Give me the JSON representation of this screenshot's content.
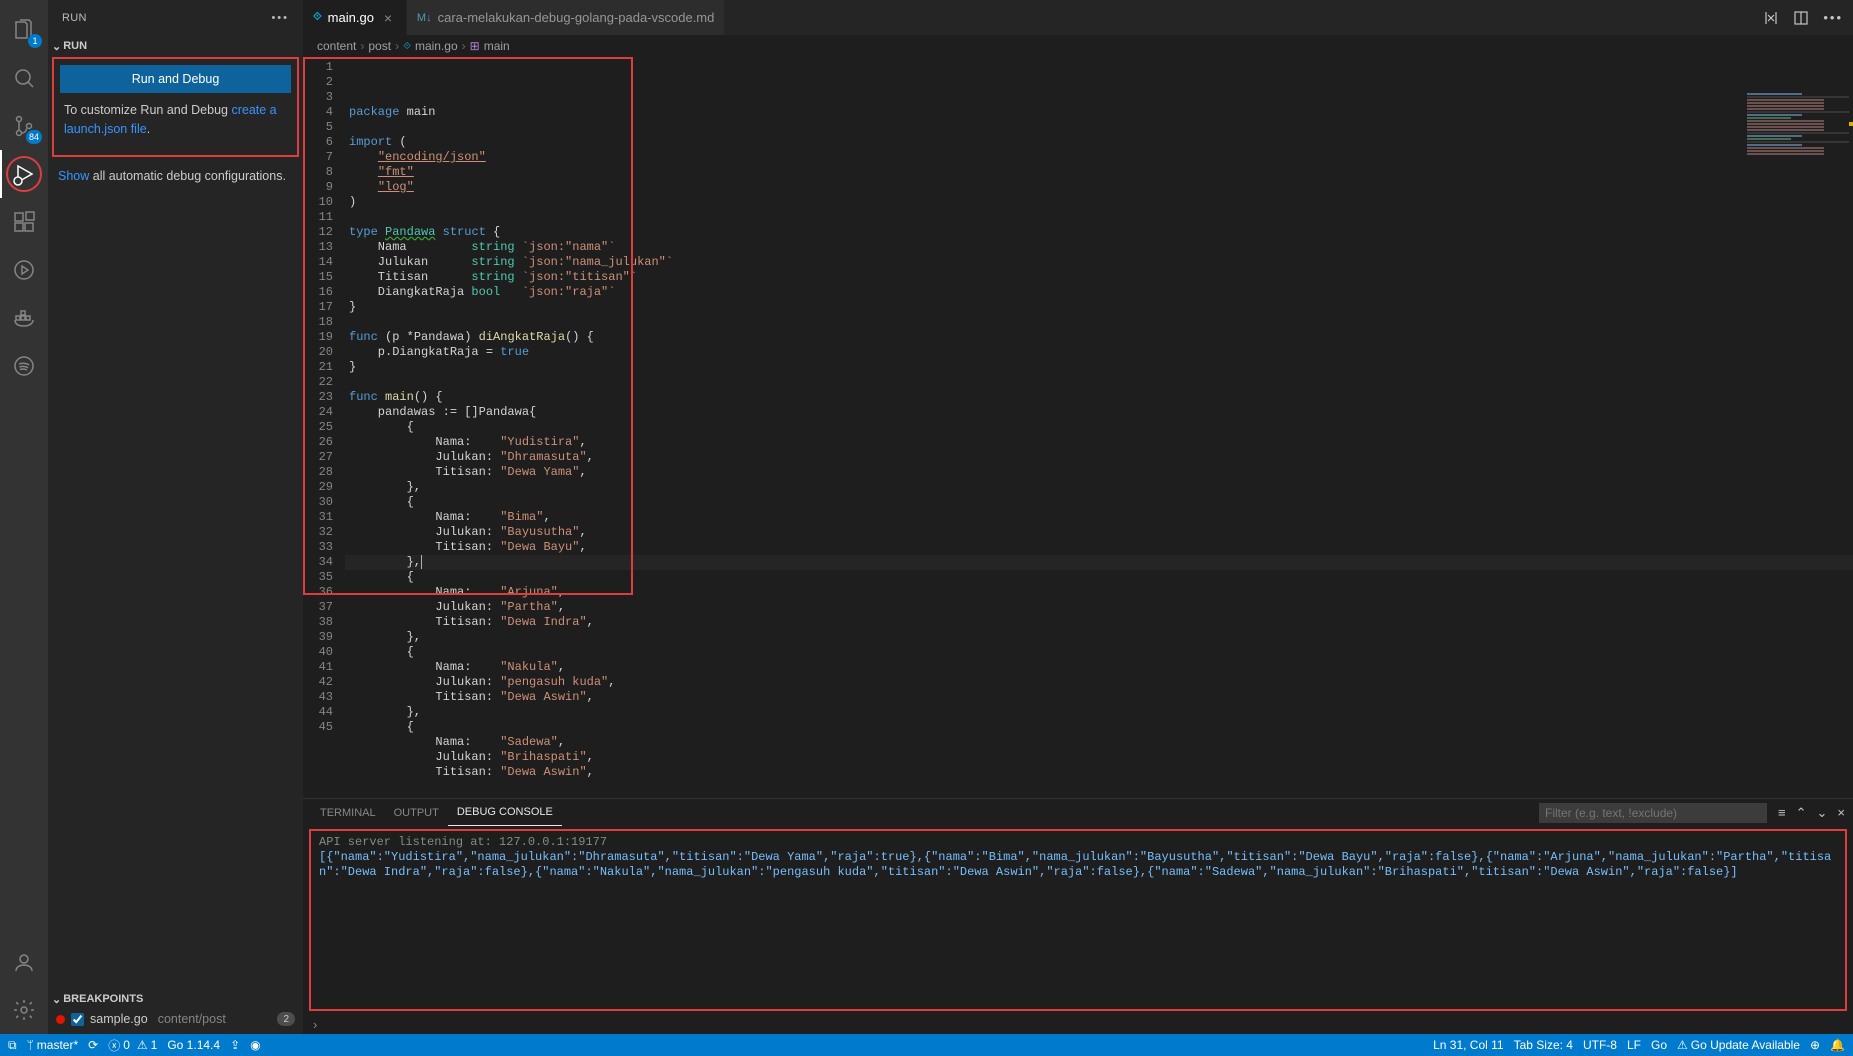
{
  "sidebar": {
    "title": "RUN",
    "section_run": "RUN",
    "run_debug_btn": "Run and Debug",
    "customize_pre": "To customize Run and Debug ",
    "customize_link": "create a launch.json file",
    "customize_post": ".",
    "show_pre": "Show",
    "show_post": " all automatic debug configurations.",
    "section_breakpoints": "BREAKPOINTS",
    "bp_file": "sample.go",
    "bp_path": "content/post",
    "bp_count": "2",
    "explorer_badge": "1",
    "scm_badge": "84"
  },
  "tabs": {
    "t1": "main.go",
    "t2": "cara-melakukan-debug-golang-pada-vscode.md"
  },
  "breadcrumb": {
    "b1": "content",
    "b2": "post",
    "b3": "main.go",
    "b4": "main"
  },
  "code_lines": [
    {
      "n": "1",
      "seg": [
        [
          "kw",
          "package"
        ],
        [
          "op",
          " main"
        ]
      ]
    },
    {
      "n": "2",
      "seg": []
    },
    {
      "n": "3",
      "seg": [
        [
          "kw",
          "import"
        ],
        [
          "op",
          " ("
        ]
      ]
    },
    {
      "n": "4",
      "seg": [
        [
          "op",
          "    "
        ],
        [
          "strimp",
          "\"encoding/json\""
        ]
      ]
    },
    {
      "n": "5",
      "seg": [
        [
          "op",
          "    "
        ],
        [
          "strimp",
          "\"fmt\""
        ]
      ]
    },
    {
      "n": "6",
      "seg": [
        [
          "op",
          "    "
        ],
        [
          "strimp",
          "\"log\""
        ]
      ]
    },
    {
      "n": "7",
      "seg": [
        [
          "op",
          ")"
        ]
      ]
    },
    {
      "n": "8",
      "seg": []
    },
    {
      "n": "9",
      "seg": [
        [
          "kw",
          "type"
        ],
        [
          "op",
          " "
        ],
        [
          "ctyp",
          "Pandawa"
        ],
        [
          "op",
          " "
        ],
        [
          "kw",
          "struct"
        ],
        [
          "op",
          " {"
        ]
      ]
    },
    {
      "n": "10",
      "seg": [
        [
          "op",
          "    Nama         "
        ],
        [
          "typ",
          "string"
        ],
        [
          "op",
          " "
        ],
        [
          "str",
          "`json:\"nama\"`"
        ]
      ]
    },
    {
      "n": "11",
      "seg": [
        [
          "op",
          "    Julukan      "
        ],
        [
          "typ",
          "string"
        ],
        [
          "op",
          " "
        ],
        [
          "str",
          "`json:\"nama_julukan\"`"
        ]
      ]
    },
    {
      "n": "12",
      "seg": [
        [
          "op",
          "    Titisan      "
        ],
        [
          "typ",
          "string"
        ],
        [
          "op",
          " "
        ],
        [
          "str",
          "`json:\"titisan\"`"
        ]
      ]
    },
    {
      "n": "13",
      "seg": [
        [
          "op",
          "    DiangkatRaja "
        ],
        [
          "typ",
          "bool"
        ],
        [
          "op",
          "   "
        ],
        [
          "str",
          "`json:\"raja\"`"
        ]
      ]
    },
    {
      "n": "14",
      "seg": [
        [
          "op",
          "}"
        ]
      ]
    },
    {
      "n": "15",
      "seg": []
    },
    {
      "n": "16",
      "seg": [
        [
          "kw",
          "func"
        ],
        [
          "op",
          " (p *Pandawa) "
        ],
        [
          "fn",
          "diAngkatRaja"
        ],
        [
          "op",
          "() {"
        ]
      ]
    },
    {
      "n": "17",
      "seg": [
        [
          "op",
          "    p.DiangkatRaja = "
        ],
        [
          "bool",
          "true"
        ]
      ]
    },
    {
      "n": "18",
      "seg": [
        [
          "op",
          "}"
        ]
      ]
    },
    {
      "n": "19",
      "seg": []
    },
    {
      "n": "20",
      "seg": [
        [
          "kw",
          "func"
        ],
        [
          "op",
          " "
        ],
        [
          "fn",
          "main"
        ],
        [
          "op",
          "() {"
        ]
      ]
    },
    {
      "n": "21",
      "seg": [
        [
          "op",
          "    pandawas := []Pandawa{"
        ]
      ]
    },
    {
      "n": "22",
      "seg": [
        [
          "op",
          "        {"
        ]
      ]
    },
    {
      "n": "23",
      "seg": [
        [
          "op",
          "            Nama:    "
        ],
        [
          "str",
          "\"Yudistira\""
        ],
        [
          "op",
          ","
        ]
      ]
    },
    {
      "n": "24",
      "seg": [
        [
          "op",
          "            Julukan: "
        ],
        [
          "str",
          "\"Dhramasuta\""
        ],
        [
          "op",
          ","
        ]
      ]
    },
    {
      "n": "25",
      "seg": [
        [
          "op",
          "            Titisan: "
        ],
        [
          "str",
          "\"Dewa Yama\""
        ],
        [
          "op",
          ","
        ]
      ]
    },
    {
      "n": "26",
      "seg": [
        [
          "op",
          "        },"
        ]
      ]
    },
    {
      "n": "27",
      "seg": [
        [
          "op",
          "        {"
        ]
      ]
    },
    {
      "n": "28",
      "seg": [
        [
          "op",
          "            Nama:    "
        ],
        [
          "str",
          "\"Bima\""
        ],
        [
          "op",
          ","
        ]
      ]
    },
    {
      "n": "29",
      "seg": [
        [
          "op",
          "            Julukan: "
        ],
        [
          "str",
          "\"Bayusutha\""
        ],
        [
          "op",
          ","
        ]
      ]
    },
    {
      "n": "30",
      "seg": [
        [
          "op",
          "            Titisan: "
        ],
        [
          "str",
          "\"Dewa Bayu\""
        ],
        [
          "op",
          ","
        ]
      ]
    },
    {
      "n": "31",
      "seg": [
        [
          "op",
          "        },"
        ],
        [
          "cursor",
          ""
        ]
      ],
      "cur": true
    },
    {
      "n": "32",
      "seg": [
        [
          "op",
          "        {"
        ]
      ]
    },
    {
      "n": "33",
      "seg": [
        [
          "op",
          "            Nama:    "
        ],
        [
          "str",
          "\"Arjuna\""
        ],
        [
          "op",
          ","
        ]
      ]
    },
    {
      "n": "34",
      "seg": [
        [
          "op",
          "            Julukan: "
        ],
        [
          "str",
          "\"Partha\""
        ],
        [
          "op",
          ","
        ]
      ]
    },
    {
      "n": "35",
      "seg": [
        [
          "op",
          "            Titisan: "
        ],
        [
          "str",
          "\"Dewa Indra\""
        ],
        [
          "op",
          ","
        ]
      ]
    },
    {
      "n": "36",
      "seg": [
        [
          "op",
          "        },"
        ]
      ]
    },
    {
      "n": "37",
      "seg": [
        [
          "op",
          "        {"
        ]
      ]
    },
    {
      "n": "38",
      "seg": [
        [
          "op",
          "            Nama:    "
        ],
        [
          "str",
          "\"Nakula\""
        ],
        [
          "op",
          ","
        ]
      ]
    },
    {
      "n": "39",
      "seg": [
        [
          "op",
          "            Julukan: "
        ],
        [
          "str",
          "\"pengasuh kuda\""
        ],
        [
          "op",
          ","
        ]
      ]
    },
    {
      "n": "40",
      "seg": [
        [
          "op",
          "            Titisan: "
        ],
        [
          "str",
          "\"Dewa Aswin\""
        ],
        [
          "op",
          ","
        ]
      ]
    },
    {
      "n": "41",
      "seg": [
        [
          "op",
          "        },"
        ]
      ]
    },
    {
      "n": "42",
      "seg": [
        [
          "op",
          "        {"
        ]
      ]
    },
    {
      "n": "43",
      "seg": [
        [
          "op",
          "            Nama:    "
        ],
        [
          "str",
          "\"Sadewa\""
        ],
        [
          "op",
          ","
        ]
      ]
    },
    {
      "n": "44",
      "seg": [
        [
          "op",
          "            Julukan: "
        ],
        [
          "str",
          "\"Brihaspati\""
        ],
        [
          "op",
          ","
        ]
      ]
    },
    {
      "n": "45",
      "seg": [
        [
          "op",
          "            Titisan: "
        ],
        [
          "str",
          "\"Dewa Aswin\""
        ],
        [
          "op",
          ","
        ]
      ]
    }
  ],
  "panel": {
    "tab_terminal": "TERMINAL",
    "tab_output": "OUTPUT",
    "tab_debug": "DEBUG CONSOLE",
    "filter_placeholder": "Filter (e.g. text, !exclude)",
    "srv_line": "API server listening at: 127.0.0.1:19177",
    "out_line": "[{\"nama\":\"Yudistira\",\"nama_julukan\":\"Dhramasuta\",\"titisan\":\"Dewa Yama\",\"raja\":true},{\"nama\":\"Bima\",\"nama_julukan\":\"Bayusutha\",\"titisan\":\"Dewa Bayu\",\"raja\":false},{\"nama\":\"Arjuna\",\"nama_julukan\":\"Partha\",\"titisan\":\"Dewa Indra\",\"raja\":false},{\"nama\":\"Nakula\",\"nama_julukan\":\"pengasuh kuda\",\"titisan\":\"Dewa Aswin\",\"raja\":false},{\"nama\":\"Sadewa\",\"nama_julukan\":\"Brihaspati\",\"titisan\":\"Dewa Aswin\",\"raja\":false}]"
  },
  "status": {
    "branch_prefix": "ᚶ ",
    "branch": "master*",
    "errors": "0",
    "warnings": "1",
    "go_version": "Go 1.14.4",
    "lncol": "Ln 31, Col 11",
    "tabsize": "Tab Size: 4",
    "encoding": "UTF-8",
    "eol": "LF",
    "lang": "Go",
    "update": "Go Update Available"
  }
}
